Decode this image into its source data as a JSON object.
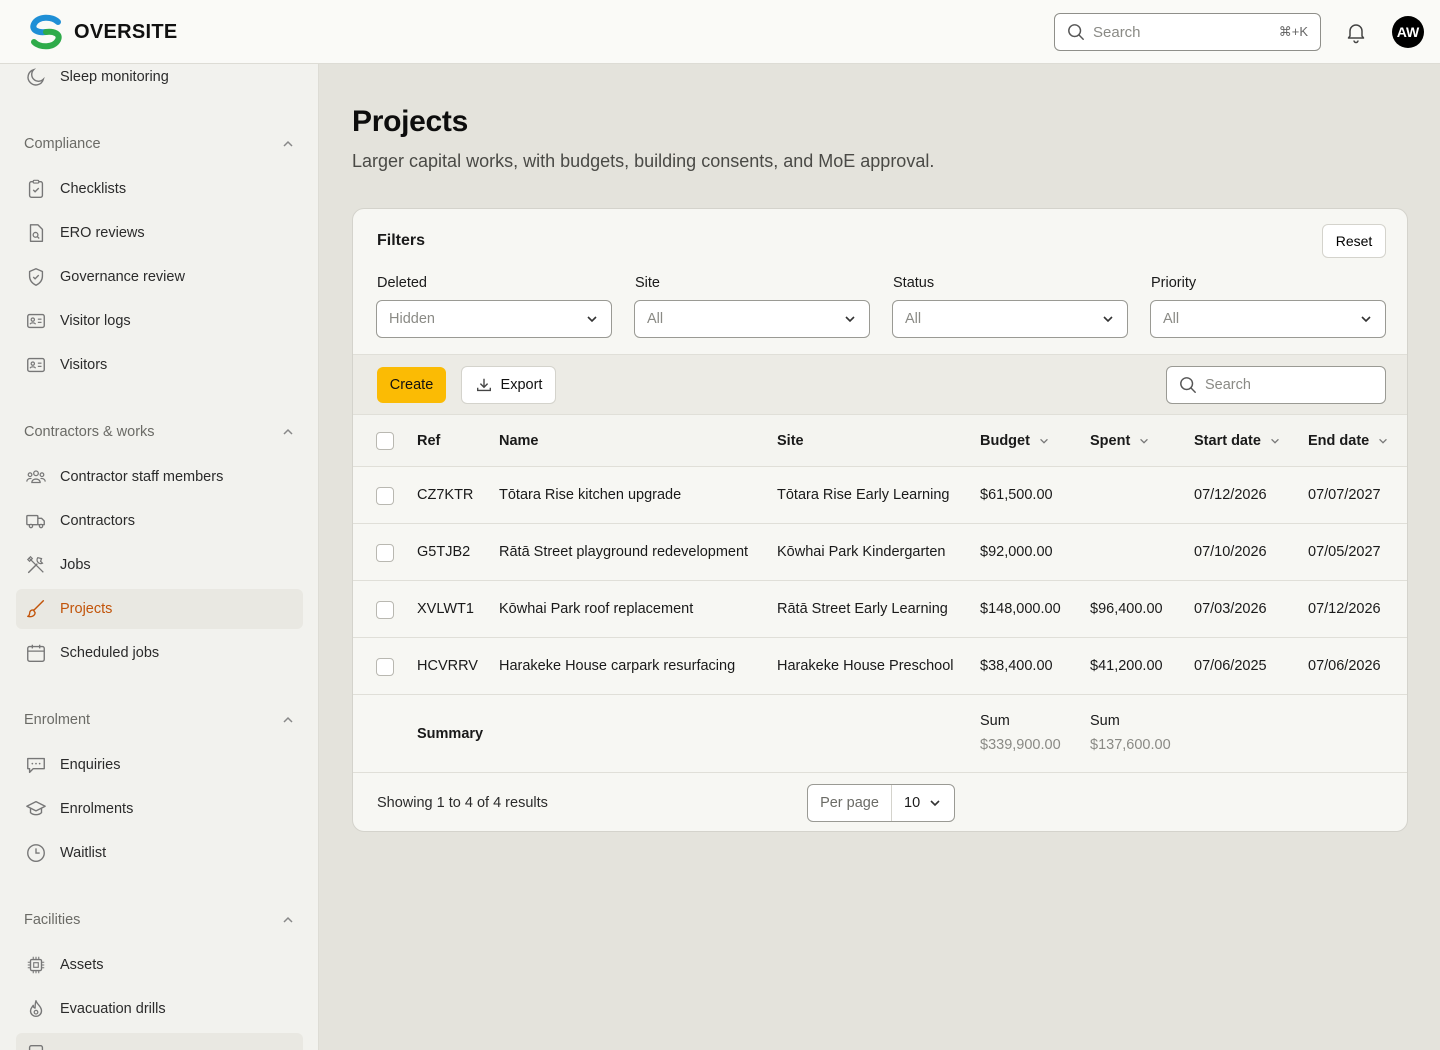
{
  "header": {
    "brand": "OVERSITE",
    "search_placeholder": "Search",
    "search_shortcut": "⌘+K",
    "avatar_initials": "AW"
  },
  "sidebar": {
    "top_item": "Sleep monitoring",
    "sections": [
      {
        "title": "Compliance",
        "items": [
          "Checklists",
          "ERO reviews",
          "Governance review",
          "Visitor logs",
          "Visitors"
        ]
      },
      {
        "title": "Contractors & works",
        "items": [
          "Contractor staff members",
          "Contractors",
          "Jobs",
          "Projects",
          "Scheduled jobs"
        ]
      },
      {
        "title": "Enrolment",
        "items": [
          "Enquiries",
          "Enrolments",
          "Waitlist"
        ]
      },
      {
        "title": "Facilities",
        "items": [
          "Assets",
          "Evacuation drills"
        ]
      }
    ],
    "active_item": "Projects"
  },
  "page": {
    "title": "Projects",
    "subtitle": "Larger capital works, with budgets, building consents, and MoE approval."
  },
  "filters": {
    "title": "Filters",
    "reset_label": "Reset",
    "fields": [
      {
        "label": "Deleted",
        "value": "Hidden"
      },
      {
        "label": "Site",
        "value": "All"
      },
      {
        "label": "Status",
        "value": "All"
      },
      {
        "label": "Priority",
        "value": "All"
      }
    ]
  },
  "toolbar": {
    "create_label": "Create",
    "export_label": "Export",
    "search_placeholder": "Search"
  },
  "table": {
    "columns": [
      "Ref",
      "Name",
      "Site",
      "Budget",
      "Spent",
      "Start date",
      "End date"
    ],
    "rows": [
      {
        "ref": "CZ7KTR",
        "name": "Tōtara Rise kitchen upgrade",
        "site": "Tōtara Rise Early Learning",
        "budget": "$61,500.00",
        "spent": "",
        "start": "07/12/2026",
        "end": "07/07/2027"
      },
      {
        "ref": "G5TJB2",
        "name": "Rātā Street playground redevelopment",
        "site": "Kōwhai Park Kindergarten",
        "budget": "$92,000.00",
        "spent": "",
        "start": "07/10/2026",
        "end": "07/05/2027"
      },
      {
        "ref": "XVLWT1",
        "name": "Kōwhai Park roof replacement",
        "site": "Rātā Street Early Learning",
        "budget": "$148,000.00",
        "spent": "$96,400.00",
        "start": "07/03/2026",
        "end": "07/12/2026"
      },
      {
        "ref": "HCVRRV",
        "name": "Harakeke House carpark resurfacing",
        "site": "Harakeke House Preschool",
        "budget": "$38,400.00",
        "spent": "$41,200.00",
        "start": "07/06/2025",
        "end": "07/06/2026"
      }
    ],
    "summary": {
      "label": "Summary",
      "budget_heading": "Sum",
      "budget_value": "$339,900.00",
      "spent_heading": "Sum",
      "spent_value": "$137,600.00"
    }
  },
  "pagination": {
    "showing_text": "Showing 1 to 4 of 4 results",
    "per_page_label": "Per page",
    "per_page_value": "10"
  },
  "colors": {
    "accent": "#fbbb04",
    "active_nav": "#c2540a"
  }
}
